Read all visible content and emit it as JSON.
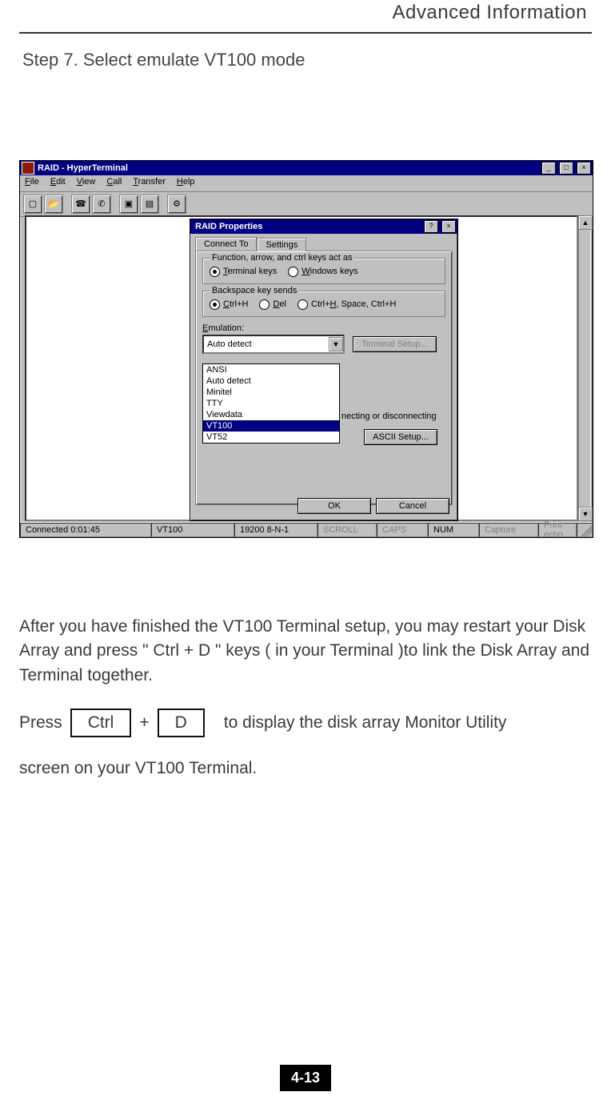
{
  "header": {
    "title": "Advanced Information"
  },
  "step": "Step 7.  Select emulate VT100 mode",
  "window": {
    "title": "RAID - HyperTerminal",
    "menus": [
      "File",
      "Edit",
      "View",
      "Call",
      "Transfer",
      "Help"
    ],
    "toolbar_icons": [
      "new-icon",
      "open-icon",
      "call-icon",
      "hangup-icon",
      "send-icon",
      "receive-icon",
      "properties-icon"
    ],
    "status": {
      "connected": "Connected 0:01:45",
      "emulation": "VT100",
      "port": "19200 8-N-1",
      "scroll": "SCROLL",
      "caps": "CAPS",
      "num": "NUM",
      "capture": "Capture",
      "printecho": "Print echo"
    }
  },
  "dialog": {
    "title": "RAID Properties",
    "tabs": [
      "Connect To",
      "Settings"
    ],
    "active_tab": 1,
    "group1": {
      "legend": "Function, arrow, and ctrl keys act as",
      "opts": [
        "Terminal keys",
        "Windows keys"
      ],
      "selected": 0
    },
    "group2": {
      "legend": "Backspace key sends",
      "opts": [
        "Ctrl+H",
        "Del",
        "Ctrl+H, Space, Ctrl+H"
      ],
      "selected": 0
    },
    "emulation_label": "Emulation:",
    "combo_value": "Auto detect",
    "terminal_setup_btn": "Terminal Setup...",
    "list": [
      "ANSI",
      "Auto detect",
      "Minitel",
      "TTY",
      "Viewdata",
      "VT100",
      "VT52"
    ],
    "list_selected": "VT100",
    "side_text": "necting or disconnecting",
    "ascii_btn": "ASCII Setup...",
    "ok": "OK",
    "cancel": "Cancel"
  },
  "body": {
    "p1": "After you have finished the VT100 Terminal setup, you may restart your Disk Array and press \" Ctrl + D \" keys ( in your Terminal )to link the Disk Array and Terminal together.",
    "press": "Press",
    "ctrl": "Ctrl",
    "plus": "+",
    "d": "D",
    "rest": "to display the disk array Monitor Utility",
    "p2": "screen on your VT100 Terminal."
  },
  "footer": "4-13"
}
